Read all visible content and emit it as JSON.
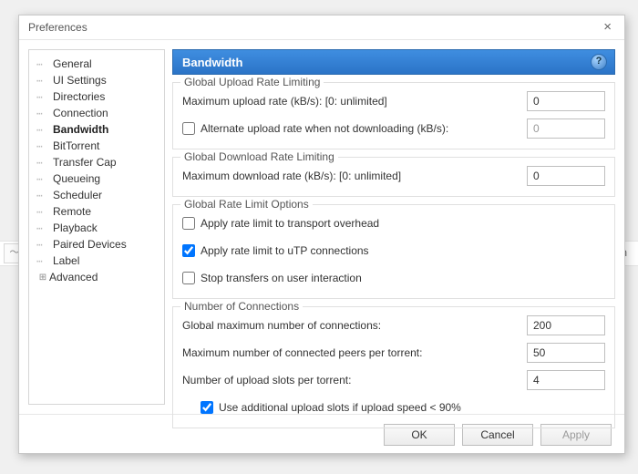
{
  "window": {
    "title": "Preferences"
  },
  "backdrop": {
    "right_clip": "ition"
  },
  "nav": {
    "items": [
      {
        "label": "General"
      },
      {
        "label": "UI Settings"
      },
      {
        "label": "Directories"
      },
      {
        "label": "Connection"
      },
      {
        "label": "Bandwidth",
        "selected": true
      },
      {
        "label": "BitTorrent"
      },
      {
        "label": "Transfer Cap"
      },
      {
        "label": "Queueing"
      },
      {
        "label": "Scheduler"
      },
      {
        "label": "Remote"
      },
      {
        "label": "Playback"
      },
      {
        "label": "Paired Devices"
      },
      {
        "label": "Label"
      },
      {
        "label": "Advanced",
        "expandable": true
      }
    ]
  },
  "header": {
    "title": "Bandwidth"
  },
  "groups": {
    "upload": {
      "title": "Global Upload Rate Limiting",
      "max_label": "Maximum upload rate (kB/s): [0: unlimited]",
      "max_value": "0",
      "alt_label": "Alternate upload rate when not downloading (kB/s):",
      "alt_checked": false,
      "alt_value": "0"
    },
    "download": {
      "title": "Global Download Rate Limiting",
      "max_label": "Maximum download rate (kB/s): [0: unlimited]",
      "max_value": "0"
    },
    "options": {
      "title": "Global Rate Limit Options",
      "overhead_label": "Apply rate limit to transport overhead",
      "overhead_checked": false,
      "utp_label": "Apply rate limit to uTP connections",
      "utp_checked": true,
      "stop_label": "Stop transfers on user interaction",
      "stop_checked": false
    },
    "connections": {
      "title": "Number of Connections",
      "global_label": "Global maximum number of connections:",
      "global_value": "200",
      "peers_label": "Maximum number of connected peers per torrent:",
      "peers_value": "50",
      "slots_label": "Number of upload slots per torrent:",
      "slots_value": "4",
      "extra_label": "Use additional upload slots if upload speed < 90%",
      "extra_checked": true
    }
  },
  "footer": {
    "ok": "OK",
    "cancel": "Cancel",
    "apply": "Apply"
  }
}
